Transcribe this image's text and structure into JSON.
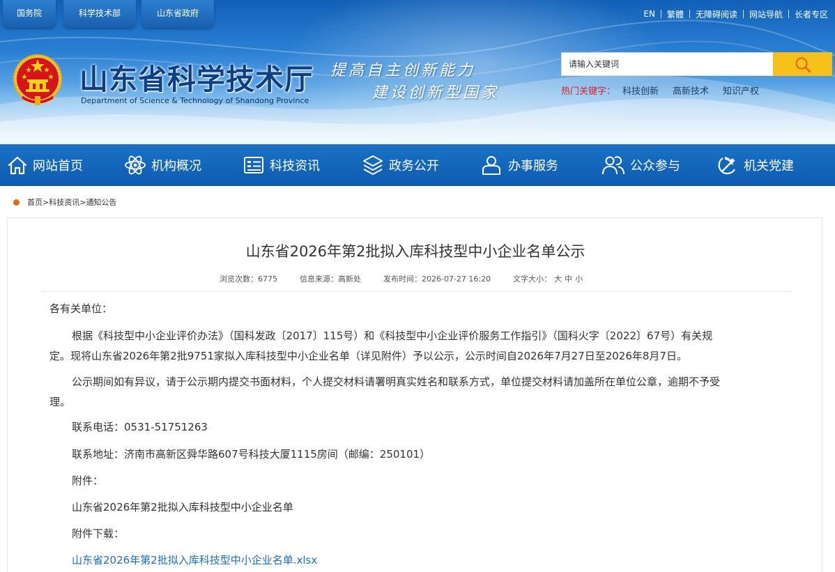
{
  "top_links": [
    "国务院",
    "科学技术部",
    "山东省政府"
  ],
  "util_links": [
    "EN",
    "繁體",
    "无障碍阅读",
    "网站导航",
    "长者专区"
  ],
  "site": {
    "title": "山东省科学技术厅",
    "subtitle": "Department of Science & Technology of Shandong Province",
    "slogan_line1": "提高自主创新能力",
    "slogan_line2": "建设创新型国家"
  },
  "search": {
    "placeholder": "请输入关键词",
    "hot_label": "热门关键字：",
    "hot_words": [
      "科技创新",
      "高新技术",
      "知识产权"
    ]
  },
  "nav": [
    {
      "label": "网站首页",
      "icon": "home-icon"
    },
    {
      "label": "机构概况",
      "icon": "atom-icon"
    },
    {
      "label": "科技资讯",
      "icon": "news-icon"
    },
    {
      "label": "政务公开",
      "icon": "layers-icon"
    },
    {
      "label": "办事服务",
      "icon": "user-service-icon"
    },
    {
      "label": "公众参与",
      "icon": "people-icon"
    },
    {
      "label": "机关党建",
      "icon": "party-emblem-icon"
    }
  ],
  "breadcrumb": [
    "首页",
    ">",
    "科技资讯",
    ">",
    "通知公告"
  ],
  "article": {
    "title": "山东省2026年第2批拟入库科技型中小企业名单公示",
    "meta": {
      "views_label": "浏览次数：",
      "views": "6775",
      "source_label": "信息来源：",
      "source": "高新处",
      "date_label": "发布时间：",
      "date": "2026-07-27 16:20",
      "font_label": "文字大小：",
      "font_sizes": [
        "大",
        "中",
        "小"
      ]
    },
    "salutation": "各有关单位：",
    "para1_line1": "根据《科技型中小企业评价办法》（国科发政〔2017〕115号）和《科技型中小企业评价服务工作指引》（国科火字〔2022〕67号）有关规",
    "para1_line2": "定。现将山东省2026年第2批9751家拟入库科技型中小企业名单（详见附件）予以公示，公示时间自2026年7月27日至2026年8月7日。",
    "para2_line1": "公示期间如有异议，请于公示期内提交书面材料，个人提交材料请署明真实姓名和联系方式，单位提交材料请加盖所在单位公章，逾期不予受",
    "para2_line2": "理。",
    "phone": "联系电话：0531-51751263",
    "address": "联系地址：济南市高新区舜华路607号科技大厦1115房间（邮编：250101）",
    "attachment_label": "附件：",
    "attachment_name": "山东省2026年第2批拟入库科技型中小企业名单",
    "download_label": "附件下载：",
    "download_link": "山东省2026年第2批拟入库科技型中小企业名单.xlsx"
  },
  "colors": {
    "nav_blue": "#0e5bb0",
    "title_blue": "#0c3f86",
    "search_yellow": "#f7c01a",
    "hot_red": "#d9222a",
    "breadcrumb_dot": "#e96a12",
    "link_blue": "#1a6fc2"
  }
}
